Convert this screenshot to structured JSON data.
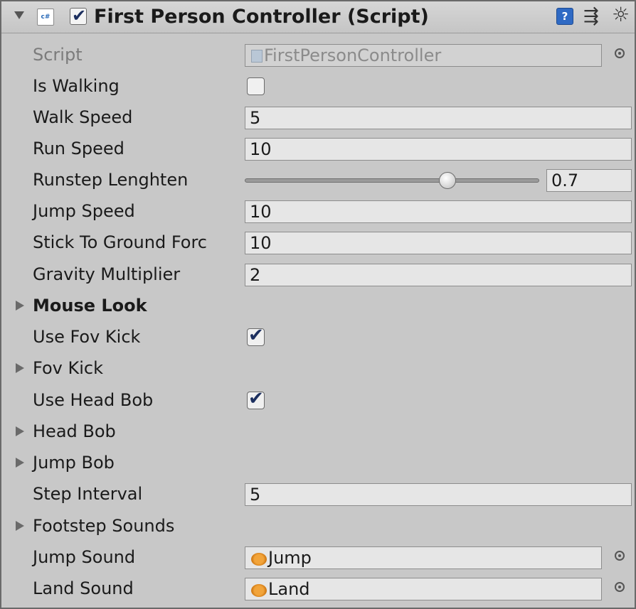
{
  "header": {
    "title": "First Person Controller (Script)",
    "script_icon": "cs-script-icon",
    "enabled": true,
    "help_label": "?",
    "preset_glyph": "⇶",
    "gear_glyph": "☼"
  },
  "colors": {
    "panel_bg": "#c8c8c8",
    "field_bg": "#e6e6e6",
    "help_blue": "#2f6ac4",
    "checkmark": "#1c2f5f",
    "audio_orange": "#f2a43a"
  },
  "rows": {
    "script": {
      "label": "Script",
      "value": "FirstPersonController"
    },
    "is_walking": {
      "label": "Is Walking",
      "checked": false
    },
    "walk_speed": {
      "label": "Walk Speed",
      "value": "5"
    },
    "run_speed": {
      "label": "Run Speed",
      "value": "10"
    },
    "runstep": {
      "label": "Runstep Lenghten",
      "value": "0.7",
      "slider_fraction": 0.7
    },
    "jump_speed": {
      "label": "Jump Speed",
      "value": "10"
    },
    "stick_to_ground": {
      "label": "Stick To Ground Forc",
      "value": "10"
    },
    "gravity_multiplier": {
      "label": "Gravity Multiplier",
      "value": "2"
    },
    "mouse_look": {
      "label": "Mouse Look"
    },
    "use_fov_kick": {
      "label": "Use Fov Kick",
      "checked": true
    },
    "fov_kick": {
      "label": "Fov Kick"
    },
    "use_head_bob": {
      "label": "Use Head Bob",
      "checked": true
    },
    "head_bob": {
      "label": "Head Bob"
    },
    "jump_bob": {
      "label": "Jump Bob"
    },
    "step_interval": {
      "label": "Step Interval",
      "value": "5"
    },
    "footstep_sounds": {
      "label": "Footstep Sounds"
    },
    "jump_sound": {
      "label": "Jump Sound",
      "value": "Jump"
    },
    "land_sound": {
      "label": "Land Sound",
      "value": "Land"
    }
  },
  "glyphs": {
    "checkmark": "✔"
  }
}
